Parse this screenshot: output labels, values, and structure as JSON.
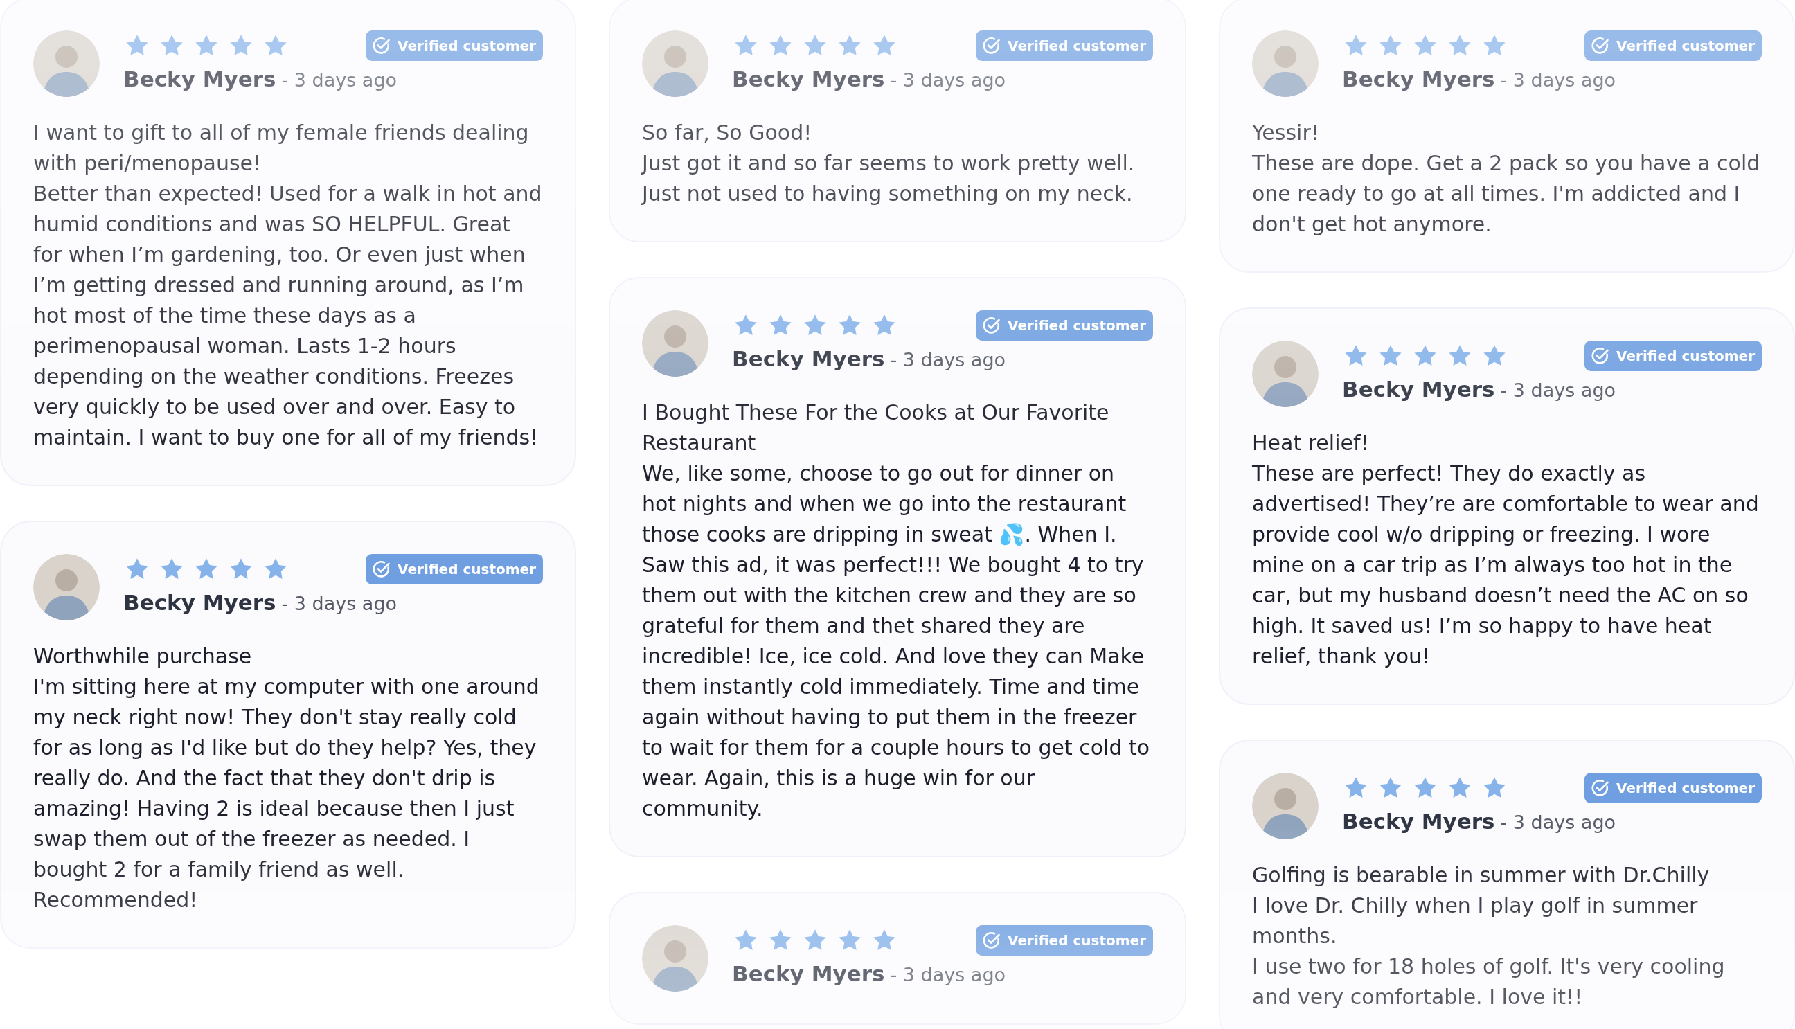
{
  "columns": [
    {
      "reviews": [
        {
          "name": "Becky Myers",
          "time": "- 3 days ago",
          "stars": 5,
          "badge": "Verified customer",
          "title": "I want to gift to all of my female friends dealing with peri/menopause!",
          "body": "Better than expected! Used for a walk in hot and humid conditions and was SO HELPFUL. Great for when I’m gardening, too. Or even just when I’m getting dressed and running around, as I’m hot most of the time these days as a perimenopausal woman. Lasts 1-2 hours depending on the weather conditions. Freezes very quickly to be used over and over. Easy to maintain. I want to buy one for all of my friends!"
        },
        {
          "name": "Becky Myers",
          "time": "- 3 days ago",
          "stars": 5,
          "badge": "Verified customer",
          "title": "Worthwhile purchase",
          "body": "I'm sitting here at my computer with one around my neck right now! They don't stay really cold for as long as I'd like but do they help? Yes, they really do. And the fact that they don't drip is amazing! Having 2 is ideal because then I just swap them out of the freezer as needed. I bought 2 for a family friend as well. Recommended!"
        }
      ]
    },
    {
      "reviews": [
        {
          "name": "Becky Myers",
          "time": "- 3 days ago",
          "stars": 5,
          "badge": "Verified customer",
          "title": "So far, So Good!",
          "body": "Just got it and so far seems to work pretty well. Just not used to having something on my neck."
        },
        {
          "name": "Becky Myers",
          "time": "- 3 days ago",
          "stars": 5,
          "badge": "Verified customer",
          "title": "I Bought These For the Cooks at Our Favorite Restaurant",
          "body": "We, like some, choose to go out for dinner on hot nights and when we go into the restaurant those cooks are dripping in sweat 💦. When I. Saw this ad, it was perfect!!! We bought 4 to try them out with the kitchen crew and they are so grateful for them and thet shared they are incredible! Ice, ice cold. And love they can Make them instantly cold immediately. Time and time again without having to put them in the freezer to wait for them for a couple hours to get cold to wear. Again, this is a huge win for our community."
        },
        {
          "name": "Becky Myers",
          "time": "- 3 days ago",
          "stars": 5,
          "badge": "Verified customer"
        }
      ]
    },
    {
      "reviews": [
        {
          "name": "Becky Myers",
          "time": "- 3 days ago",
          "stars": 5,
          "badge": "Verified customer",
          "title": "Yessir!",
          "body": "These are dope. Get a 2 pack so you have a cold one ready to go at all times. I'm addicted and I don't get hot anymore."
        },
        {
          "name": "Becky Myers",
          "time": "- 3 days ago",
          "stars": 5,
          "badge": "Verified customer",
          "title": "Heat relief!",
          "body": "These are perfect! They do exactly as advertised! They’re are comfortable to wear and provide cool w/o dripping or freezing. I wore mine on a car trip as I’m always too hot in the car, but my husband doesn’t need the AC on so high. It saved us! I’m so happy to have heat relief, thank you!"
        },
        {
          "name": "Becky Myers",
          "time": "- 3 days ago",
          "stars": 5,
          "badge": "Verified customer",
          "title": "Golfing is bearable in summer with Dr.Chilly",
          "body": "I love Dr. Chilly when I play golf in summer months.\nI use two for 18 holes of golf. It's very cooling and very comfortable. I love it!!"
        }
      ]
    }
  ]
}
